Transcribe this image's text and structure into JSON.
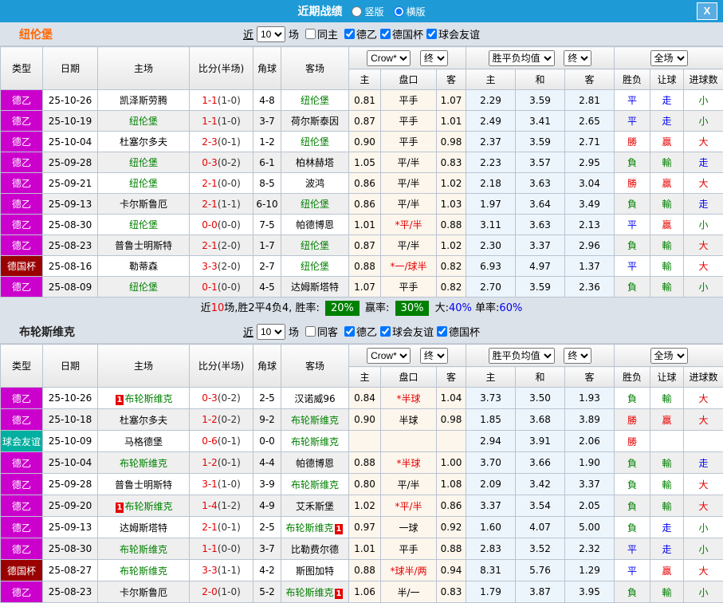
{
  "titlebar": {
    "title": "近期战绩",
    "radio_vertical": "竖版",
    "radio_horizontal": "横版",
    "close": "X"
  },
  "header": {
    "type": "类型",
    "date": "日期",
    "home": "主场",
    "score": "比分(半场)",
    "corners": "角球",
    "away": "客场",
    "odds_select": "Crow*",
    "final1": "终",
    "avg_select": "胜平负均值",
    "final2": "终",
    "scope_select": "全场",
    "a_home": "主",
    "a_line": "盘口",
    "a_away": "客",
    "e_home": "主",
    "e_draw": "和",
    "e_away": "客",
    "winloss": "胜负",
    "handicap": "让球",
    "goals": "进球数"
  },
  "colors": {
    "titlebar": "#1e9bd7",
    "leagues": {
      "德乙": "#cc00cc",
      "德国杯": "#9a0000",
      "球会友谊": "#00afa0"
    },
    "subject_team": "#008000",
    "red": "#e60000",
    "blue": "#0000ee",
    "green": "#008000"
  },
  "sections": [
    {
      "team": "纽伦堡",
      "team_color": "#ff6600",
      "filter": {
        "near": "近",
        "count": "10",
        "games": "场",
        "same": "同主",
        "leagues": [
          "德乙",
          "德国杯",
          "球会友谊"
        ]
      },
      "rows": [
        {
          "type": "德乙",
          "date": "25-10-26",
          "home": {
            "name": "凯泽斯劳腾"
          },
          "score": "1-1",
          "half": "(1-0)",
          "corners": "4-8",
          "away": {
            "name": "纽伦堡",
            "subject": true
          },
          "asian": [
            "0.81",
            "平手",
            "1.07"
          ],
          "euro": [
            "2.29",
            "3.59",
            "2.81"
          ],
          "outcome": [
            "平",
            "走",
            "小"
          ]
        },
        {
          "type": "德乙",
          "date": "25-10-19",
          "home": {
            "name": "纽伦堡",
            "subject": true
          },
          "score": "1-1",
          "half": "(1-0)",
          "corners": "3-7",
          "away": {
            "name": "荷尔斯泰因"
          },
          "asian": [
            "0.87",
            "平手",
            "1.01"
          ],
          "euro": [
            "2.49",
            "3.41",
            "2.65"
          ],
          "outcome": [
            "平",
            "走",
            "小"
          ]
        },
        {
          "type": "德乙",
          "date": "25-10-04",
          "home": {
            "name": "杜塞尔多夫"
          },
          "score": "2-3",
          "half": "(0-1)",
          "corners": "1-2",
          "away": {
            "name": "纽伦堡",
            "subject": true
          },
          "asian": [
            "0.90",
            "平手",
            "0.98"
          ],
          "euro": [
            "2.37",
            "3.59",
            "2.71"
          ],
          "outcome": [
            "勝",
            "贏",
            "大"
          ]
        },
        {
          "type": "德乙",
          "date": "25-09-28",
          "home": {
            "name": "纽伦堡",
            "subject": true
          },
          "score": "0-3",
          "half": "(0-2)",
          "corners": "6-1",
          "away": {
            "name": "柏林赫塔"
          },
          "asian": [
            "1.05",
            "平/半",
            "0.83"
          ],
          "euro": [
            "2.23",
            "3.57",
            "2.95"
          ],
          "outcome": [
            "負",
            "輸",
            "走"
          ]
        },
        {
          "type": "德乙",
          "date": "25-09-21",
          "home": {
            "name": "纽伦堡",
            "subject": true
          },
          "score": "2-1",
          "half": "(0-0)",
          "corners": "8-5",
          "away": {
            "name": "波鸿"
          },
          "asian": [
            "0.86",
            "平/半",
            "1.02"
          ],
          "euro": [
            "2.18",
            "3.63",
            "3.04"
          ],
          "outcome": [
            "勝",
            "贏",
            "大"
          ]
        },
        {
          "type": "德乙",
          "date": "25-09-13",
          "home": {
            "name": "卡尔斯鲁厄"
          },
          "score": "2-1",
          "half": "(1-1)",
          "corners": "6-10",
          "away": {
            "name": "纽伦堡",
            "subject": true
          },
          "asian": [
            "0.86",
            "平/半",
            "1.03"
          ],
          "euro": [
            "1.97",
            "3.64",
            "3.49"
          ],
          "outcome": [
            "負",
            "輸",
            "走"
          ]
        },
        {
          "type": "德乙",
          "date": "25-08-30",
          "home": {
            "name": "纽伦堡",
            "subject": true
          },
          "score": "0-0",
          "half": "(0-0)",
          "corners": "7-5",
          "away": {
            "name": "帕德博恩"
          },
          "asian": [
            "1.01",
            "*平/半",
            "0.88"
          ],
          "euro": [
            "3.11",
            "3.63",
            "2.13"
          ],
          "outcome": [
            "平",
            "贏",
            "小"
          ]
        },
        {
          "type": "德乙",
          "date": "25-08-23",
          "home": {
            "name": "普鲁士明斯特"
          },
          "score": "2-1",
          "half": "(2-0)",
          "corners": "1-7",
          "away": {
            "name": "纽伦堡",
            "subject": true
          },
          "asian": [
            "0.87",
            "平/半",
            "1.02"
          ],
          "euro": [
            "2.30",
            "3.37",
            "2.96"
          ],
          "outcome": [
            "負",
            "輸",
            "大"
          ]
        },
        {
          "type": "德国杯",
          "date": "25-08-16",
          "home": {
            "name": "勒蒂森"
          },
          "score": "3-3",
          "half": "(2-0)",
          "corners": "2-7",
          "away": {
            "name": "纽伦堡",
            "subject": true
          },
          "asian": [
            "0.88",
            "*一/球半",
            "0.82"
          ],
          "euro": [
            "6.93",
            "4.97",
            "1.37"
          ],
          "outcome": [
            "平",
            "輸",
            "大"
          ]
        },
        {
          "type": "德乙",
          "date": "25-08-09",
          "home": {
            "name": "纽伦堡",
            "subject": true
          },
          "score": "0-1",
          "half": "(0-0)",
          "corners": "4-5",
          "away": {
            "name": "达姆斯塔特"
          },
          "asian": [
            "1.07",
            "平手",
            "0.82"
          ],
          "euro": [
            "2.70",
            "3.59",
            "2.36"
          ],
          "outcome": [
            "負",
            "輸",
            "小"
          ]
        }
      ],
      "summary": {
        "part1": "近",
        "count": "10",
        "part2": "场,胜2平4负4, 胜率:",
        "rate_win": "20%",
        "label_profit": "赢率:",
        "rate_profit": "30%",
        "label_big": "大:",
        "rate_big": "40%",
        "label_single": "单率:",
        "rate_single": "60%"
      }
    },
    {
      "team": "布轮斯维克",
      "team_color": "#222222",
      "filter": {
        "near": "近",
        "count": "10",
        "games": "场",
        "same": "同客",
        "leagues": [
          "德乙",
          "球会友谊",
          "德国杯"
        ]
      },
      "rows": [
        {
          "type": "德乙",
          "date": "25-10-26",
          "home": {
            "name": "布轮斯维克",
            "subject": true,
            "card": "1"
          },
          "score": "0-3",
          "half": "(0-2)",
          "corners": "2-5",
          "away": {
            "name": "汉诺威96"
          },
          "asian": [
            "0.84",
            "*半球",
            "1.04"
          ],
          "euro": [
            "3.73",
            "3.50",
            "1.93"
          ],
          "outcome": [
            "負",
            "輸",
            "大"
          ]
        },
        {
          "type": "德乙",
          "date": "25-10-18",
          "home": {
            "name": "杜塞尔多夫"
          },
          "score": "1-2",
          "half": "(0-2)",
          "corners": "9-2",
          "away": {
            "name": "布轮斯维克",
            "subject": true
          },
          "asian": [
            "0.90",
            "半球",
            "0.98"
          ],
          "euro": [
            "1.85",
            "3.68",
            "3.89"
          ],
          "outcome": [
            "勝",
            "贏",
            "大"
          ]
        },
        {
          "type": "球会友谊",
          "date": "25-10-09",
          "home": {
            "name": "马格德堡"
          },
          "score": "0-6",
          "half": "(0-1)",
          "corners": "0-0",
          "away": {
            "name": "布轮斯维克",
            "subject": true
          },
          "asian": [
            "",
            "",
            ""
          ],
          "euro": [
            "2.94",
            "3.91",
            "2.06"
          ],
          "outcome": [
            "勝",
            "",
            ""
          ]
        },
        {
          "type": "德乙",
          "date": "25-10-04",
          "home": {
            "name": "布轮斯维克",
            "subject": true
          },
          "score": "1-2",
          "half": "(0-1)",
          "corners": "4-4",
          "away": {
            "name": "帕德博恩"
          },
          "asian": [
            "0.88",
            "*半球",
            "1.00"
          ],
          "euro": [
            "3.70",
            "3.66",
            "1.90"
          ],
          "outcome": [
            "負",
            "輸",
            "走"
          ]
        },
        {
          "type": "德乙",
          "date": "25-09-28",
          "home": {
            "name": "普鲁士明斯特"
          },
          "score": "3-1",
          "half": "(1-0)",
          "corners": "3-9",
          "away": {
            "name": "布轮斯维克",
            "subject": true
          },
          "asian": [
            "0.80",
            "平/半",
            "1.08"
          ],
          "euro": [
            "2.09",
            "3.42",
            "3.37"
          ],
          "outcome": [
            "負",
            "輸",
            "大"
          ]
        },
        {
          "type": "德乙",
          "date": "25-09-20",
          "home": {
            "name": "布轮斯维克",
            "subject": true,
            "card": "1"
          },
          "score": "1-4",
          "half": "(1-2)",
          "corners": "4-9",
          "away": {
            "name": "艾禾斯堡"
          },
          "asian": [
            "1.02",
            "*平/半",
            "0.86"
          ],
          "euro": [
            "3.37",
            "3.54",
            "2.05"
          ],
          "outcome": [
            "負",
            "輸",
            "大"
          ]
        },
        {
          "type": "德乙",
          "date": "25-09-13",
          "home": {
            "name": "达姆斯塔特"
          },
          "score": "2-1",
          "half": "(0-1)",
          "corners": "2-5",
          "away": {
            "name": "布轮斯维克",
            "subject": true,
            "card": "1"
          },
          "asian": [
            "0.97",
            "一球",
            "0.92"
          ],
          "euro": [
            "1.60",
            "4.07",
            "5.00"
          ],
          "outcome": [
            "負",
            "走",
            "小"
          ]
        },
        {
          "type": "德乙",
          "date": "25-08-30",
          "home": {
            "name": "布轮斯维克",
            "subject": true
          },
          "score": "1-1",
          "half": "(0-0)",
          "corners": "3-7",
          "away": {
            "name": "比勒费尔德"
          },
          "asian": [
            "1.01",
            "平手",
            "0.88"
          ],
          "euro": [
            "2.83",
            "3.52",
            "2.32"
          ],
          "outcome": [
            "平",
            "走",
            "小"
          ]
        },
        {
          "type": "德国杯",
          "date": "25-08-27",
          "home": {
            "name": "布轮斯维克",
            "subject": true
          },
          "score": "3-3",
          "half": "(1-1)",
          "corners": "4-2",
          "away": {
            "name": "斯图加特"
          },
          "asian": [
            "0.88",
            "*球半/两",
            "0.94"
          ],
          "euro": [
            "8.31",
            "5.76",
            "1.29"
          ],
          "outcome": [
            "平",
            "贏",
            "大"
          ]
        },
        {
          "type": "德乙",
          "date": "25-08-23",
          "home": {
            "name": "卡尔斯鲁厄"
          },
          "score": "2-0",
          "half": "(1-0)",
          "corners": "5-2",
          "away": {
            "name": "布轮斯维克",
            "subject": true,
            "card": "1"
          },
          "asian": [
            "1.06",
            "半/一",
            "0.83"
          ],
          "euro": [
            "1.79",
            "3.87",
            "3.95"
          ],
          "outcome": [
            "負",
            "輸",
            "小"
          ]
        }
      ]
    }
  ]
}
